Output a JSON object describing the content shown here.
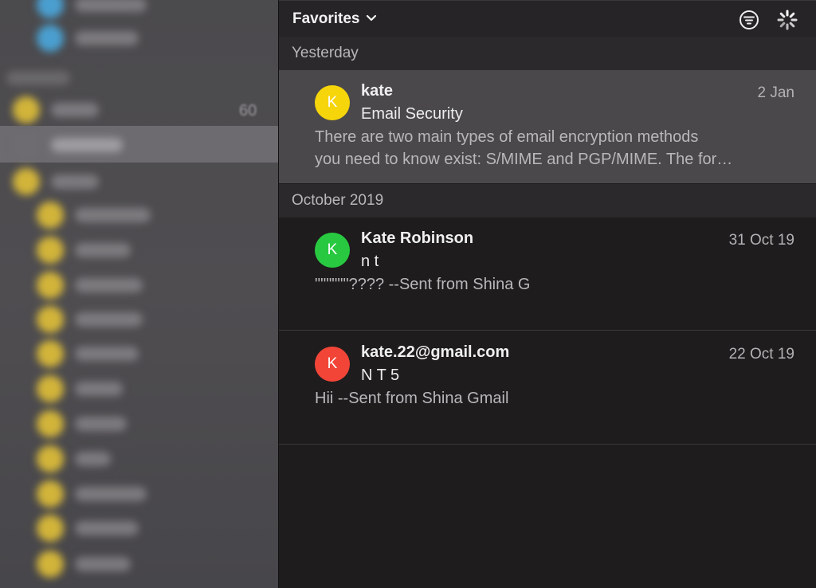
{
  "toolbar": {
    "mailbox_title": "Favorites",
    "icons": [
      "chevron-down-icon",
      "filter-icon",
      "loading-spinner-icon"
    ]
  },
  "sidebar": {
    "count_badge": "60"
  },
  "sections": [
    {
      "header": "Yesterday",
      "messages": [
        {
          "avatar_letter": "K",
          "avatar_color": "#f6d50b",
          "sender": "kate",
          "date": "2 Jan",
          "subject": "Email Security",
          "preview_line1": "There are two main types of email encryption methods",
          "preview_line2": "you need to know exist: S/MIME and PGP/MIME. The for…",
          "selected": true
        }
      ]
    },
    {
      "header": "October 2019",
      "messages": [
        {
          "avatar_letter": "K",
          "avatar_color": "#28c940",
          "sender": "Kate Robinson",
          "date": "31 Oct 19",
          "subject": "n t",
          "preview_line1": "\"\"\"\"\"\"???? --Sent from Shina G",
          "preview_line2": ""
        },
        {
          "avatar_letter": "K",
          "avatar_color": "#f24538",
          "sender": "kate.22@gmail.com",
          "date": "22 Oct 19",
          "subject": "N T 5",
          "preview_line1": "Hii --Sent from Shina Gmail",
          "preview_line2": ""
        }
      ]
    }
  ],
  "colors": {
    "background": "#1e1c1d",
    "selected_row": "#4a484b",
    "section_header": "#2b292b",
    "sidebar": "#4b4a4d"
  }
}
